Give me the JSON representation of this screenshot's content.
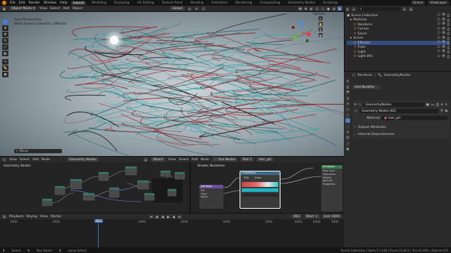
{
  "menus": [
    "File",
    "Edit",
    "Render",
    "Window",
    "Help"
  ],
  "workspaces": [
    "Layout",
    "Modeling",
    "Sculpting",
    "UV Editing",
    "Texture Paint",
    "Shading",
    "Animation",
    "Rendering",
    "Compositing",
    "Geometry Nodes",
    "Scripting"
  ],
  "active_workspace": "Layout",
  "scene_field": "Scene",
  "view_layer_field": "ViewLayer",
  "viewport_header": {
    "mode": "Object Mode",
    "menus": [
      "View",
      "Select",
      "Add",
      "Object"
    ],
    "orientation": "Global",
    "options_label": "Options"
  },
  "viewport_overlay": {
    "line1": "User Perspective",
    "line2": "(663) Scene Collection | Effector"
  },
  "viewport_input_placeholder": "Move",
  "node_header": {
    "menus": [
      "View",
      "Select",
      "Add",
      "Node"
    ],
    "tree": "Geometry Nodes",
    "label": "Geometry Nodes"
  },
  "shader_header": {
    "menus": [
      "Slot 1",
      "View",
      "Select",
      "Add",
      "Node"
    ],
    "object_label": "Object",
    "use_nodes": "Use Nodes",
    "material": "hair_ptr",
    "label": "Shader Nodetree"
  },
  "shader_nodes": {
    "principled_label": "Principled",
    "ramp_label": "ColorRamp",
    "output_label": "Material",
    "attribute_label": "Attribute",
    "ramp_buttons": [
      "RGB",
      "Linear"
    ],
    "sockets": [
      "Fac",
      "Color",
      "Alpha",
      "Base Color",
      "Subsurface",
      "Metallic",
      "Specular",
      "Roughness"
    ]
  },
  "timeline_header": {
    "menus": [
      "Playback",
      "Keying",
      "View",
      "Marker"
    ],
    "current_frame": "663",
    "start_label": "Start",
    "start": "1",
    "end_label": "End",
    "end": "5500"
  },
  "frame_marks": [
    "1000",
    "1500",
    "2000",
    "2500",
    "3000",
    "3500",
    "4000",
    "4500",
    "5000"
  ],
  "playhead_label": "663",
  "status": {
    "select": "Select",
    "box_select": "Box Select",
    "lasso": "Lasso Select",
    "right": "Scene Collection | Verts:17,438 | Faces:23,613 | Tris:43,950 | Objects:0/5"
  },
  "outliner": {
    "title": "Scene Collection",
    "rows": [
      {
        "label": "Scene Collection",
        "indent": 0,
        "selected": false
      },
      {
        "label": "Particles",
        "indent": 1,
        "selected": false
      },
      {
        "label": "Renderer",
        "indent": 2,
        "selected": false
      },
      {
        "label": "Curves",
        "indent": 2,
        "selected": false
      },
      {
        "label": "Saver",
        "indent": 2,
        "selected": false
      },
      {
        "label": "Scene",
        "indent": 1,
        "selected": false
      },
      {
        "label": "Effector",
        "indent": 2,
        "selected": true
      },
      {
        "label": "Floor",
        "indent": 2,
        "selected": false
      },
      {
        "label": "Light",
        "indent": 2,
        "selected": false
      },
      {
        "label": "Light.001",
        "indent": 2,
        "selected": false
      }
    ]
  },
  "properties": {
    "breadcrumb_a": "Renderer",
    "breadcrumb_b": "GeometryNodes",
    "add_modifier": "Add Modifier",
    "modifier_name": "GeometryNodes",
    "node_group": "Geometry Nodes.002",
    "material_label": "Material",
    "material_value": "hair_ptr",
    "output_attributes": "Output Attributes",
    "internal_deps": "Internal Dependencies"
  },
  "colors": {
    "accent": "#4772b3",
    "orange": "#e87d0d",
    "hair_teal": "#3aa7a8",
    "hair_red": "#b0343a"
  }
}
